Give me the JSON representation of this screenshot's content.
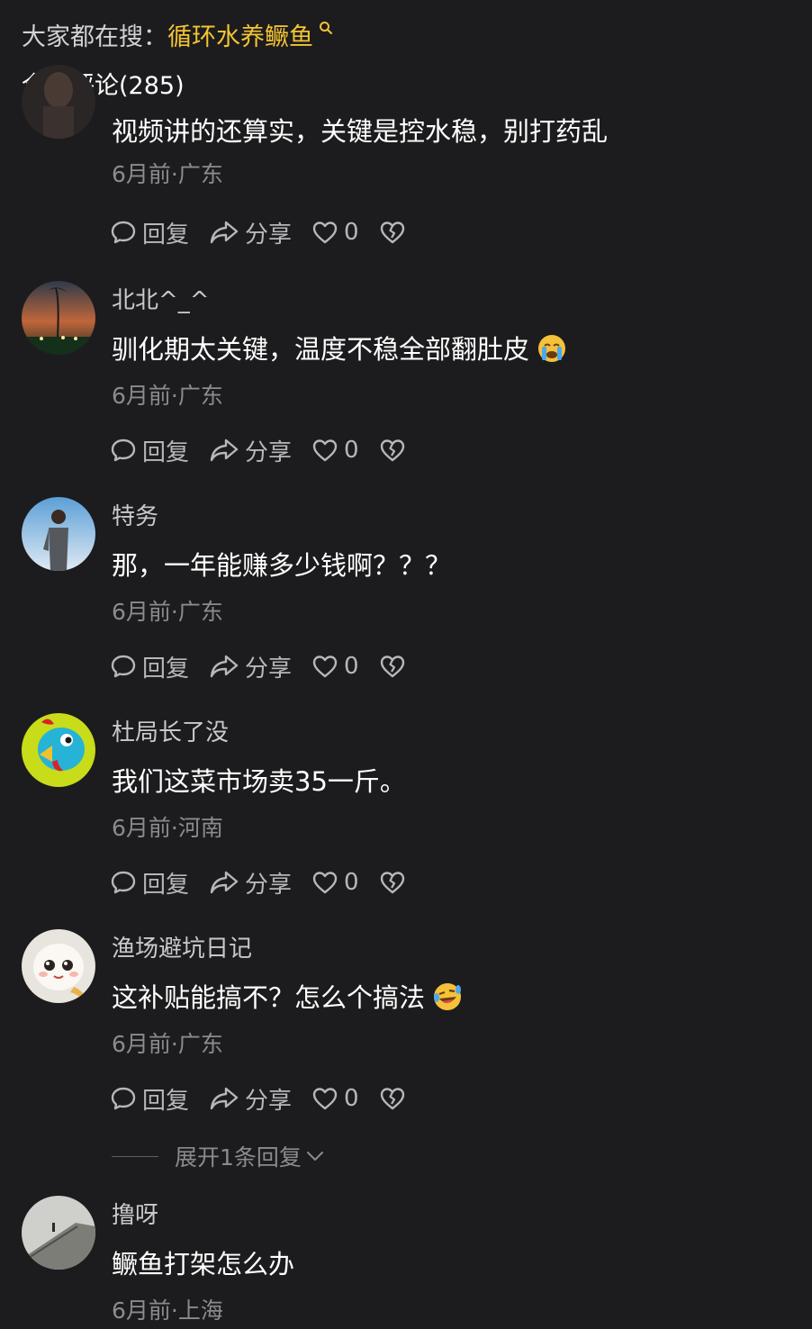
{
  "search": {
    "prefix": "大家都在搜：",
    "term": "循环水养鳜鱼"
  },
  "header": {
    "title": "全部评论(285)"
  },
  "colors": {
    "background": "#1c1c1e",
    "accent": "#f3c432",
    "secondary_text": "#8b8b8e"
  },
  "comments": [
    {
      "username": "",
      "text": "视频讲的还算实，关键是控水稳，别打药乱",
      "meta": "6月前·广东",
      "reply_label": "回复",
      "share_label": "分享",
      "likes": "0"
    },
    {
      "username": "北北^_^",
      "text": "驯化期太关键，温度不稳全部翻肚皮",
      "emoji": "loudly-crying-face",
      "meta": "6月前·广东",
      "reply_label": "回复",
      "share_label": "分享",
      "likes": "0"
    },
    {
      "username": "特务",
      "text": "那，一年能赚多少钱啊？？？",
      "meta": "6月前·广东",
      "reply_label": "回复",
      "share_label": "分享",
      "likes": "0"
    },
    {
      "username": "杜局长了没",
      "text": "我们这菜市场卖35一斤。",
      "meta": "6月前·河南",
      "reply_label": "回复",
      "share_label": "分享",
      "likes": "0"
    },
    {
      "username": "渔场避坑日记",
      "text": "这补贴能搞不？怎么个搞法",
      "emoji": "laughing-crying-face",
      "meta": "6月前·广东",
      "reply_label": "回复",
      "share_label": "分享",
      "likes": "0",
      "expand_label": "展开1条回复"
    },
    {
      "username": "撸呀",
      "text": "鳜鱼打架怎么办",
      "meta": "6月前·上海"
    }
  ]
}
